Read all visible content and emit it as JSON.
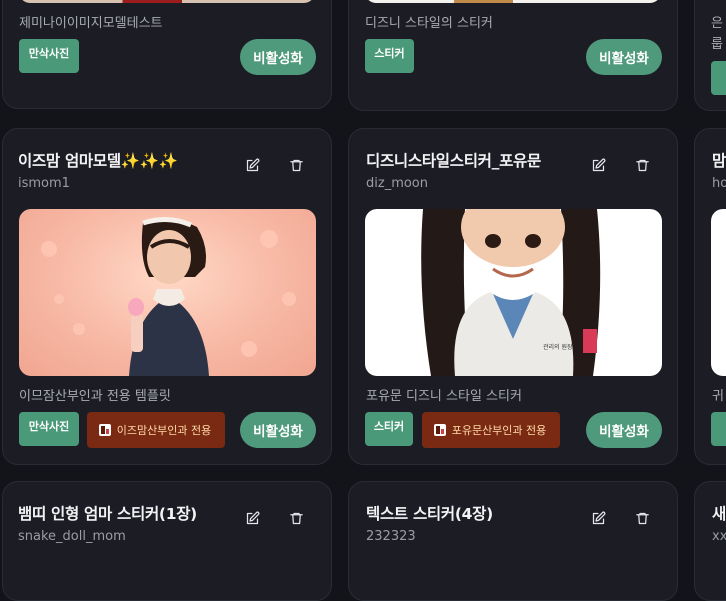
{
  "cards_top": [
    {
      "desc": "제미나이이미지모델테스트",
      "tag": "만삭사진",
      "deactivate": "비활성화"
    },
    {
      "desc": "디즈니 스타일의 스티커",
      "tag": "스티커",
      "deactivate": "비활성화"
    },
    {
      "desc": "은",
      "desc2": "룹",
      "tag": "만"
    }
  ],
  "cards_mid": [
    {
      "title": "이즈맘 엄마모델✨✨✨",
      "username": "ismom1",
      "desc": "이므잠산부인과 전용 템플릿",
      "tag": "만삭사진",
      "clinic_tag": "이즈맘산부인과 전용",
      "deactivate": "비활성화"
    },
    {
      "title": "디즈니스타일스티커_포유문",
      "username": "diz_moon",
      "desc": "포유문 디즈니 스타일 스티커",
      "tag": "스티커",
      "clinic_tag": "포유문산부인과 전용",
      "deactivate": "비활성화",
      "coat_text": "관리의 원장"
    },
    {
      "title": "맘",
      "username": "ho",
      "desc": "귀",
      "tag": "스"
    }
  ],
  "cards_bottom": [
    {
      "title": "뱀띠 인형 엄마 스티커(1장)",
      "username": "snake_doll_mom"
    },
    {
      "title": "텍스트 스티커(4장)",
      "username": "232323"
    },
    {
      "title": "새",
      "username": "xx"
    }
  ],
  "colors": {
    "background": "#131419",
    "card": "#1c1d24",
    "accent_green": "#4f9a7c",
    "tag_green": "#4a9a7a",
    "clinic_tag": "#7a2a12"
  },
  "icons": {
    "edit": "edit-icon",
    "delete": "trash-icon",
    "clinic": "clinic-icon"
  }
}
